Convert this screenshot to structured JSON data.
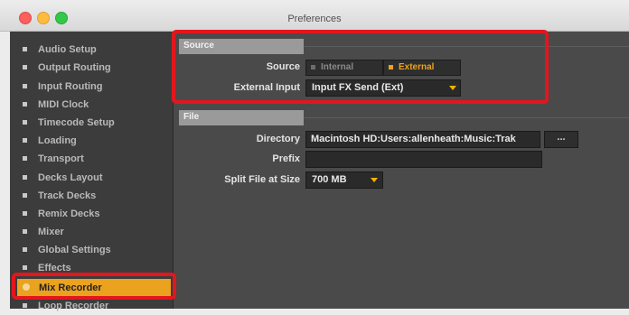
{
  "window": {
    "title": "Preferences"
  },
  "sidebar": {
    "items": [
      {
        "label": "Audio Setup"
      },
      {
        "label": "Output Routing"
      },
      {
        "label": "Input Routing"
      },
      {
        "label": "MIDI Clock"
      },
      {
        "label": "Timecode Setup"
      },
      {
        "label": "Loading"
      },
      {
        "label": "Transport"
      },
      {
        "label": "Decks Layout"
      },
      {
        "label": "Track Decks"
      },
      {
        "label": "Remix Decks"
      },
      {
        "label": "Mixer"
      },
      {
        "label": "Global Settings"
      },
      {
        "label": "Effects"
      },
      {
        "label": "Mix Recorder"
      },
      {
        "label": "Loop Recorder"
      }
    ],
    "selected": "Mix Recorder"
  },
  "source_section": {
    "header": "Source",
    "source_label": "Source",
    "options": [
      {
        "label": "Internal",
        "selected": false
      },
      {
        "label": "External",
        "selected": true
      }
    ],
    "external_input_label": "External Input",
    "external_input_value": "Input FX Send (Ext)"
  },
  "file_section": {
    "header": "File",
    "directory_label": "Directory",
    "directory_value": "Macintosh HD:Users:allenheath:Music:Trak",
    "browse_label": "...",
    "prefix_label": "Prefix",
    "prefix_value": "",
    "split_label": "Split File at Size",
    "split_value": "700 MB"
  },
  "colors": {
    "accent": "#eaa21f",
    "highlight": "#e3161d",
    "panel": "#4a4a4a",
    "sidebar": "#3c3c3c"
  }
}
